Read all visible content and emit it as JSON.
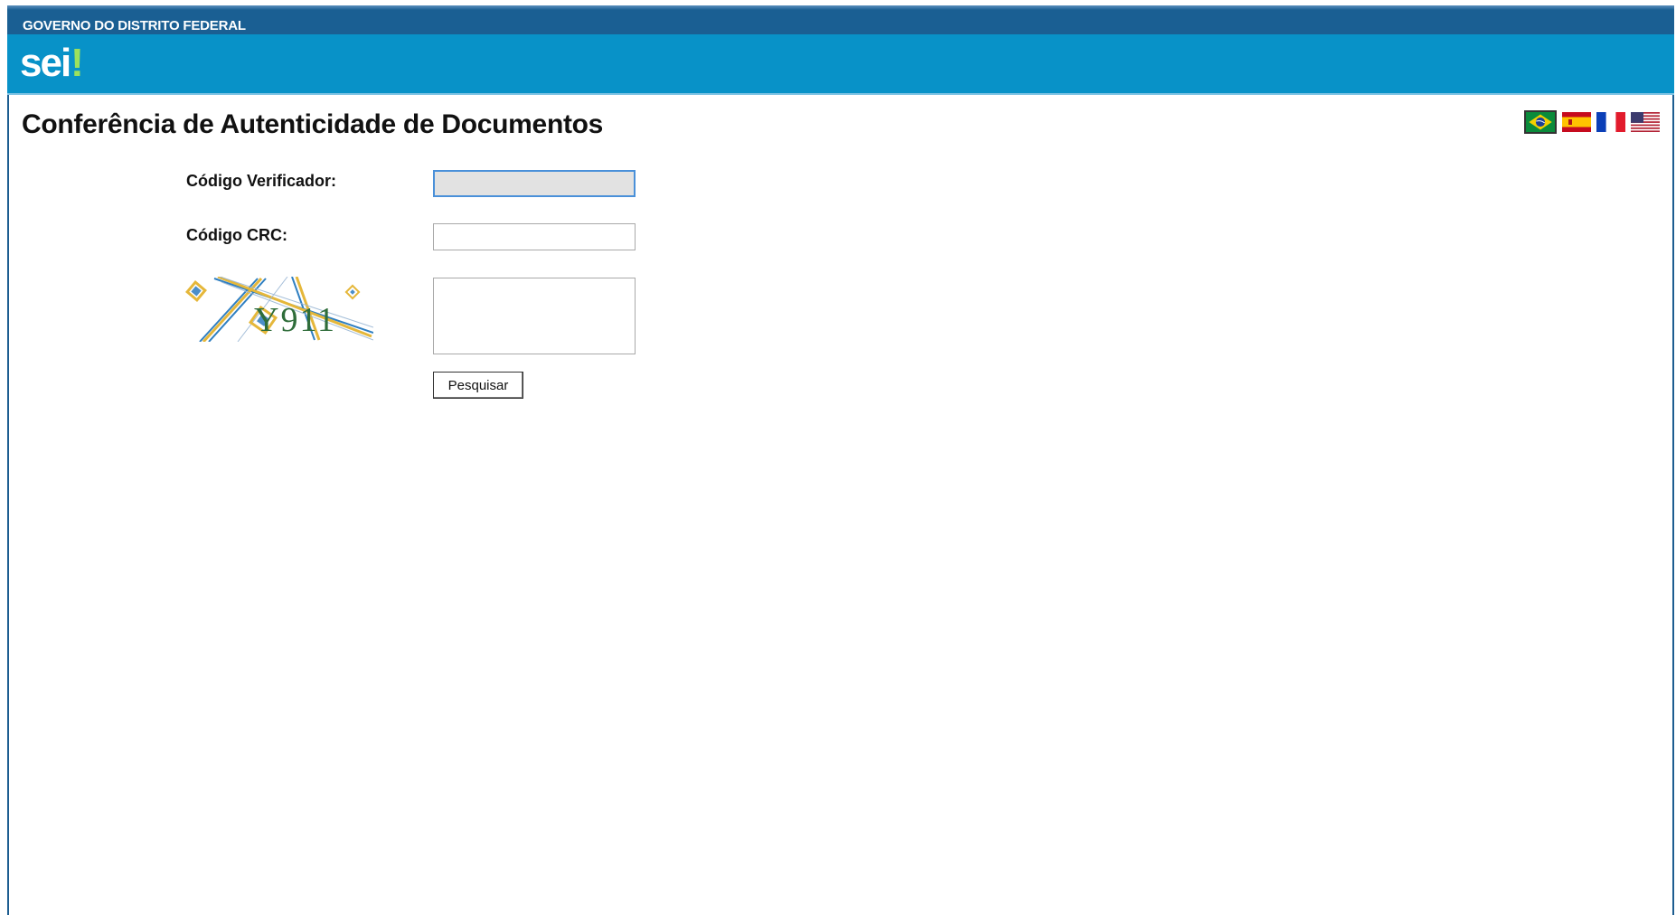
{
  "header": {
    "government_label": "GOVERNO DO DISTRITO FEDERAL",
    "logo_text": "sei",
    "logo_mark": "!"
  },
  "page": {
    "title": "Conferência de Autenticidade de Documentos"
  },
  "languages": [
    {
      "name": "brazil-flag-icon",
      "selected": true
    },
    {
      "name": "spain-flag-icon",
      "selected": false
    },
    {
      "name": "france-flag-icon",
      "selected": false
    },
    {
      "name": "usa-flag-icon",
      "selected": false
    }
  ],
  "form": {
    "codigo_verificador_label": "Código Verificador:",
    "codigo_verificador_value": "",
    "codigo_crc_label": "Código CRC:",
    "codigo_crc_value": "",
    "captcha_text": "Y911",
    "captcha_answer": "",
    "search_button_label": "Pesquisar"
  },
  "colors": {
    "top_bar": "#1a5f93",
    "brand_bar": "#0892c8",
    "logo_accent": "#9be15d"
  }
}
